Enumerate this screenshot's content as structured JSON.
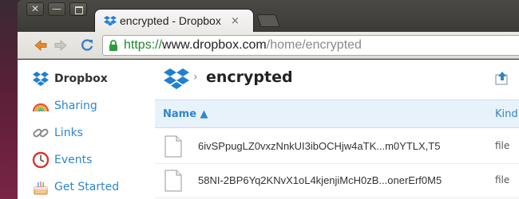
{
  "window": {
    "close_glyph": "✕",
    "min_glyph": "—"
  },
  "tab": {
    "title": "encrypted - Dropbox",
    "close_glyph": "×"
  },
  "toolbar": {
    "url_scheme": "https://",
    "url_host": "www.dropbox.com",
    "url_path": "/home/encrypted"
  },
  "sidebar": {
    "items": [
      {
        "label": "Dropbox",
        "icon": "dropbox-icon"
      },
      {
        "label": "Sharing",
        "icon": "rainbow-icon"
      },
      {
        "label": "Links",
        "icon": "link-icon"
      },
      {
        "label": "Events",
        "icon": "clock-icon"
      },
      {
        "label": "Get Started",
        "icon": "cake-icon"
      }
    ]
  },
  "main": {
    "breadcrumb_sep": "›",
    "folder_title": "encrypted",
    "columns": {
      "name": "Name ▲",
      "kind": "Kind"
    },
    "files": [
      {
        "name": "6ivSPpugLZ0vxzNnkUI3ibOCHjw4aTK...m0YTLX,T5",
        "kind": "file"
      },
      {
        "name": "58NI-2BP6Yq2KNvX1oL4kjenjiMcH0zB...onerErf0M5",
        "kind": "file"
      }
    ]
  },
  "colors": {
    "accent": "#2f86cc",
    "url_green": "#1c8a2a",
    "header_bg": "#e8f2fb"
  }
}
